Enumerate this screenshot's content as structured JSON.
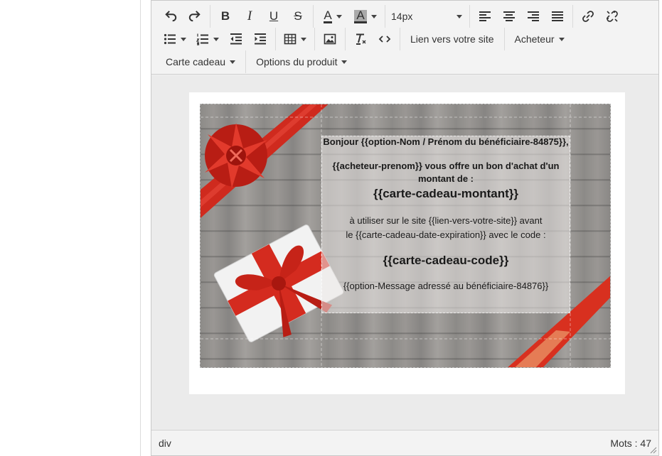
{
  "toolbar": {
    "font_size": "14px",
    "link_site_label": "Lien vers votre site",
    "buyer_label": "Acheteur",
    "gift_card_label": "Carte cadeau",
    "product_options_label": "Options du produit",
    "text_color_letter": "A",
    "bg_color_letter": "A",
    "bold_letter": "B",
    "italic_letter": "I",
    "underline_letter": "U",
    "strike_letter": "S"
  },
  "card": {
    "greeting": "Bonjour {{option-Nom / Prénom du bénéficiaire-84875}},",
    "offer": "{{acheteur-prenom}} vous offre un bon d'achat d'un montant de :",
    "amount": "{{carte-cadeau-montant}}",
    "use_line1": "à utiliser sur le site {{lien-vers-votre-site}} avant",
    "use_line2": "le {{carte-cadeau-date-expiration}}  avec le code :",
    "code": "{{carte-cadeau-code}}",
    "message": "{{option-Message adressé au bénéficiaire-84876}}"
  },
  "status": {
    "path": "div",
    "word_count": "Mots : 47"
  },
  "colors": {
    "ribbon": "#d42b1f",
    "wood": "#8f8c89",
    "gift_box": "#f4f4f4"
  }
}
